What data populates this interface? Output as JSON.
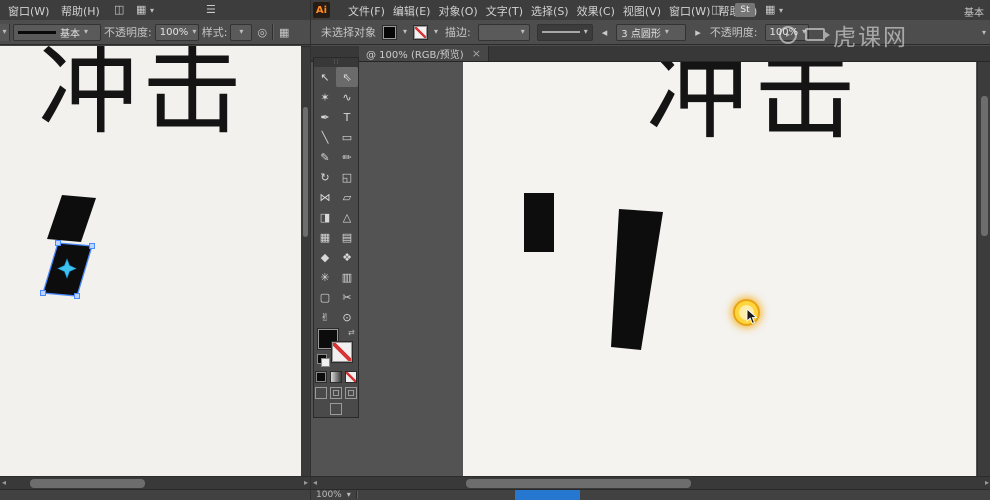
{
  "app": {
    "logo": "Ai",
    "workspace_label": "基本"
  },
  "left_window": {
    "menu_items": [
      "窗口(W)",
      "帮助(H)"
    ],
    "options": {
      "brush_preview_label": "基本",
      "opacity_label": "不透明度:",
      "opacity_value": "100%",
      "style_label": "样式:"
    },
    "canvas_text": "冲击"
  },
  "right_window": {
    "menu_items": [
      "文件(F)",
      "编辑(E)",
      "对象(O)",
      "文字(T)",
      "选择(S)",
      "效果(C)",
      "视图(V)",
      "窗口(W)",
      "帮助(H)"
    ],
    "st_badge": "St",
    "options": {
      "selection_status": "未选择对象",
      "stroke_label": "描边:",
      "brush_name": "3 点圆形",
      "opacity_label": "不透明度:",
      "opacity_value": "100%"
    },
    "doc_tab": {
      "title": "@ 100% (RGB/预览)",
      "close": "×"
    },
    "canvas_text": "冲击",
    "status_zoom": "100%"
  },
  "watermark": {
    "text": "虎课网"
  },
  "icons": {
    "caret_down": "▾",
    "left_arrow": "◂",
    "right_arrow": "▸",
    "grid": "▦",
    "layout": "◫",
    "list": "☰",
    "circle": "◎",
    "swap": "⇄",
    "dots": "∷"
  },
  "toolbar": {
    "tools": [
      {
        "name": "selection",
        "glyph": "↖"
      },
      {
        "name": "direct-selection",
        "glyph": "⇖"
      },
      {
        "name": "magic-wand",
        "glyph": "✶"
      },
      {
        "name": "lasso",
        "glyph": "∿"
      },
      {
        "name": "pen",
        "glyph": "✒"
      },
      {
        "name": "type",
        "glyph": "T"
      },
      {
        "name": "line-segment",
        "glyph": "╲"
      },
      {
        "name": "rectangle",
        "glyph": "▭"
      },
      {
        "name": "paintbrush",
        "glyph": "✎"
      },
      {
        "name": "pencil",
        "glyph": "✏"
      },
      {
        "name": "rotate",
        "glyph": "↻"
      },
      {
        "name": "scale",
        "glyph": "◱"
      },
      {
        "name": "width",
        "glyph": "⋈"
      },
      {
        "name": "free-transform",
        "glyph": "▱"
      },
      {
        "name": "shape-builder",
        "glyph": "◨"
      },
      {
        "name": "perspective-grid",
        "glyph": "△"
      },
      {
        "name": "mesh",
        "glyph": "▦"
      },
      {
        "name": "gradient",
        "glyph": "▤"
      },
      {
        "name": "eyedropper",
        "glyph": "◆"
      },
      {
        "name": "blend",
        "glyph": "❖"
      },
      {
        "name": "symbol-sprayer",
        "glyph": "✳"
      },
      {
        "name": "column-graph",
        "glyph": "▥"
      },
      {
        "name": "artboard",
        "glyph": "▢"
      },
      {
        "name": "slice",
        "glyph": "✂"
      },
      {
        "name": "hand",
        "glyph": "✌"
      },
      {
        "name": "zoom",
        "glyph": "⊙"
      }
    ]
  },
  "colors": {
    "selection_blue": "#4a8cff",
    "sparkle_cyan": "#3cc3f0",
    "highlight_yellow": "#ffd53e",
    "taskbar_blue": "#2577cf"
  }
}
